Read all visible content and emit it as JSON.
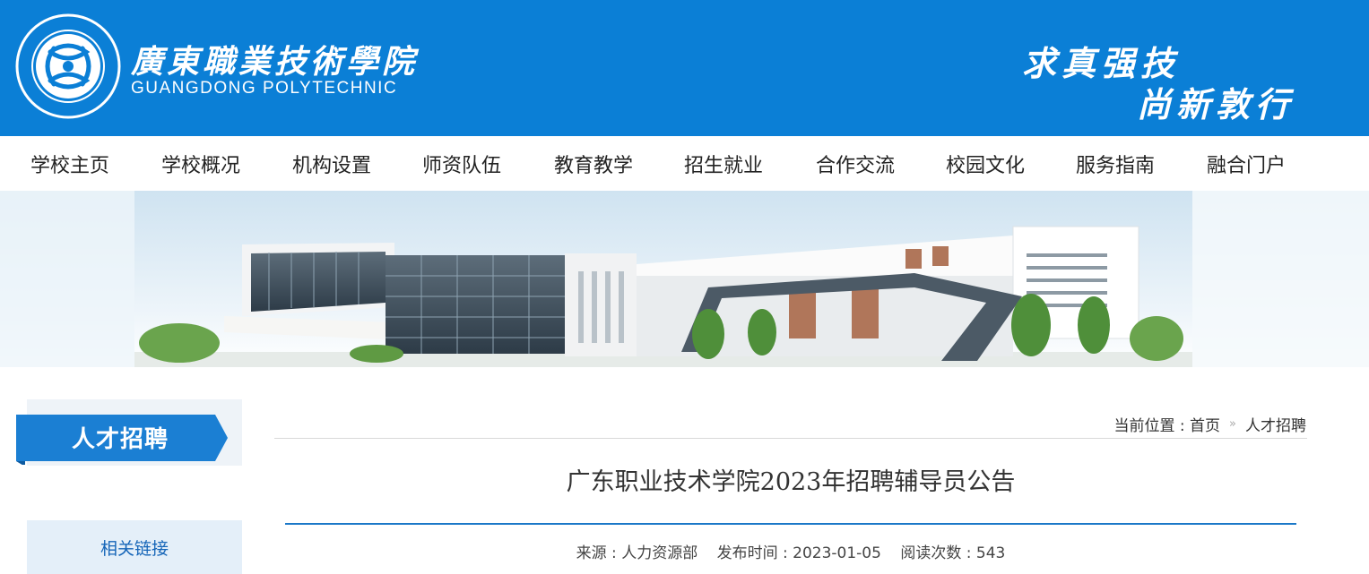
{
  "header": {
    "logo_cn": "廣東職業技術學院",
    "logo_en": "GUANGDONG POLYTECHNIC",
    "slogan_line1": "求真强技",
    "slogan_line2": "尚新敦行",
    "bg_color": "#0b7fd6"
  },
  "nav": {
    "items": [
      "学校主页",
      "学校概况",
      "机构设置",
      "师资队伍",
      "教育教学",
      "招生就业",
      "合作交流",
      "校园文化",
      "服务指南",
      "融合门户"
    ]
  },
  "sidebar": {
    "title": "人才招聘",
    "links_label": "相关链接"
  },
  "breadcrumb": {
    "prefix": "当前位置 : ",
    "home": "首页",
    "separator": "»",
    "current": "人才招聘"
  },
  "article": {
    "title": "广东职业技术学院2023年招聘辅导员公告",
    "source": "来源 : 人力资源部",
    "published": "发布时间 : 2023-01-05",
    "views": "阅读次数 : 543"
  },
  "colors": {
    "accent": "#1b78c8",
    "nav_text": "#222222"
  }
}
